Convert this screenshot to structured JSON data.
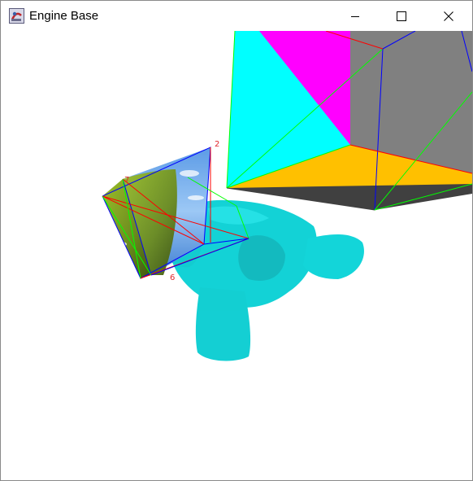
{
  "window": {
    "title": "Engine Base",
    "controls": {
      "minimize": "minimize-icon",
      "maximize": "maximize-icon",
      "close": "close-icon"
    }
  },
  "scene": {
    "vertex_labels": {
      "a": "2",
      "b": "7",
      "c": "6"
    },
    "colors": {
      "cyan": "#00ffff",
      "magenta": "#ff00ff",
      "gray": "#808080",
      "orange": "#ffc000",
      "dark": "#404040",
      "mesh": "#00cfd3",
      "edge_red": "#ff0000",
      "edge_green": "#00ff00",
      "edge_blue": "#0000ff"
    }
  }
}
